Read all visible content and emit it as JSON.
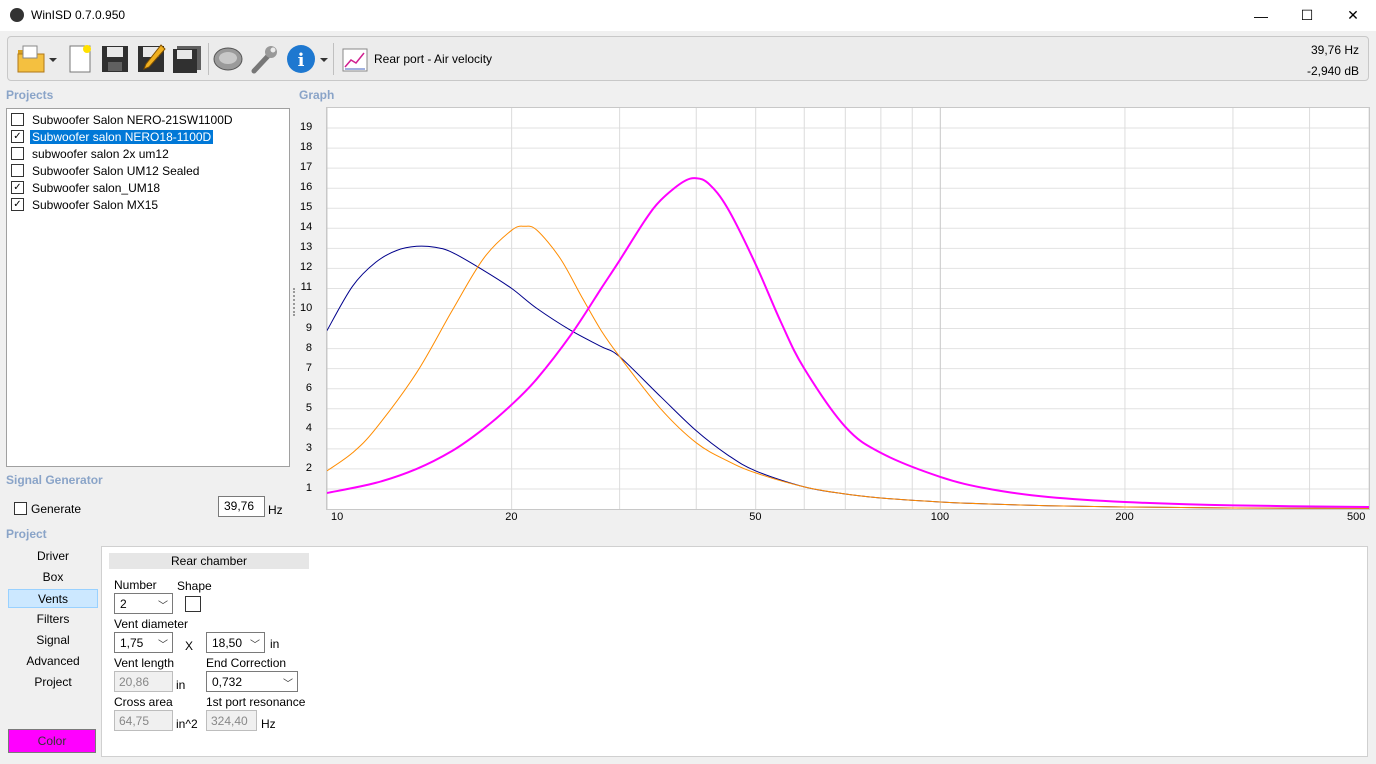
{
  "window": {
    "title": "WinISD 0.7.0.950",
    "minimize": "—",
    "maximize": "☐",
    "close": "✕"
  },
  "toolbar": {
    "graph_title": "Rear port - Air velocity",
    "readout_hz": "39,76 Hz",
    "readout_db": "-2,940 dB"
  },
  "projects": {
    "label": "Projects",
    "items": [
      {
        "name": "Subwoofer Salon NERO-21SW1100D",
        "checked": false,
        "check": ""
      },
      {
        "name": "Subwoofer salon NERO18-1100D",
        "checked": true,
        "check": "✓"
      },
      {
        "name": "subwoofer salon 2x um12",
        "checked": false,
        "check": ""
      },
      {
        "name": "Subwoofer Salon UM12 Sealed",
        "checked": false,
        "check": ""
      },
      {
        "name": "Subwoofer salon_UM18",
        "checked": true,
        "check": "✓"
      },
      {
        "name": "Subwoofer Salon MX15",
        "checked": true,
        "check": "✓"
      }
    ]
  },
  "signal_generator": {
    "label": "Signal Generator",
    "generate_label": "Generate",
    "frequency": "39,76",
    "unit": "Hz"
  },
  "graph": {
    "label": "Graph",
    "y_ticks": [
      "19",
      "18",
      "17",
      "16",
      "15",
      "14",
      "13",
      "12",
      "11",
      "10",
      "9",
      "8",
      "7",
      "6",
      "5",
      "4",
      "3",
      "2",
      "1"
    ],
    "x_ticks": [
      "10",
      "20",
      "50",
      "100",
      "200",
      "500"
    ]
  },
  "chart_data": {
    "type": "line",
    "x_scale": "log",
    "xlim": [
      10,
      500
    ],
    "ylim": [
      0,
      20
    ],
    "grid": true,
    "x_ticks": [
      10,
      20,
      50,
      100,
      200,
      500
    ],
    "y_ticks": [
      1,
      2,
      3,
      4,
      5,
      6,
      7,
      8,
      9,
      10,
      11,
      12,
      13,
      14,
      15,
      16,
      17,
      18,
      19
    ],
    "series": [
      {
        "color": "#00008b",
        "width": 1,
        "x": [
          10,
          11,
          12,
          13,
          14,
          15,
          16,
          18,
          20,
          22,
          25,
          28,
          30,
          35,
          40,
          45,
          50,
          60,
          70,
          80,
          100,
          120,
          150,
          200,
          300,
          500
        ],
        "y": [
          8.9,
          11.1,
          12.3,
          12.9,
          13.1,
          13.05,
          12.8,
          11.9,
          11.0,
          10.0,
          8.9,
          8.1,
          7.6,
          5.6,
          3.9,
          2.7,
          1.9,
          1.1,
          0.75,
          0.55,
          0.35,
          0.25,
          0.16,
          0.1,
          0.05,
          0.03
        ]
      },
      {
        "color": "#ff8c00",
        "width": 1,
        "x": [
          10,
          11,
          12,
          14,
          16,
          18,
          20,
          21,
          22,
          24,
          26,
          28,
          30,
          35,
          40,
          45,
          50,
          60,
          70,
          80,
          100,
          120,
          150,
          200,
          300,
          500
        ],
        "y": [
          1.9,
          2.8,
          4.0,
          6.8,
          9.9,
          12.5,
          13.9,
          14.1,
          13.9,
          12.5,
          10.6,
          8.9,
          7.6,
          5.0,
          3.3,
          2.4,
          1.8,
          1.1,
          0.75,
          0.55,
          0.35,
          0.25,
          0.16,
          0.1,
          0.05,
          0.03
        ]
      },
      {
        "color": "#ff00ff",
        "width": 2,
        "x": [
          10,
          12,
          14,
          16,
          18,
          20,
          22,
          25,
          28,
          30,
          33,
          35,
          38,
          40,
          42,
          45,
          50,
          55,
          60,
          70,
          80,
          100,
          120,
          150,
          200,
          300,
          500
        ],
        "y": [
          0.8,
          1.3,
          2.0,
          2.9,
          4.0,
          5.2,
          6.5,
          8.7,
          11.0,
          12.4,
          14.4,
          15.4,
          16.3,
          16.5,
          16.2,
          15.0,
          12.2,
          9.3,
          7.0,
          4.1,
          2.8,
          1.6,
          1.0,
          0.6,
          0.35,
          0.18,
          0.1
        ]
      }
    ]
  },
  "project_nav": {
    "label": "Project",
    "items": [
      "Driver",
      "Box",
      "Vents",
      "Filters",
      "Signal",
      "Advanced",
      "Project"
    ],
    "active": "Vents",
    "color_button": "Color",
    "color": "#ff00ff"
  },
  "vents": {
    "section_title": "Rear chamber",
    "number_label": "Number",
    "number_value": "2",
    "shape_label": "Shape",
    "vent_diameter_label": "Vent diameter",
    "vent_diameter_value": "1,75",
    "x_label": "X",
    "second_dim_value": "18,50",
    "second_dim_unit": "in",
    "vent_length_label": "Vent length",
    "vent_length_value": "20,86",
    "vent_length_unit": "in",
    "end_correction_label": "End Correction",
    "end_correction_value": "0,732",
    "cross_area_label": "Cross area",
    "cross_area_value": "64,75",
    "cross_area_unit": "in^2",
    "port_res_label": "1st port resonance",
    "port_res_value": "324,40",
    "port_res_unit": "Hz"
  }
}
